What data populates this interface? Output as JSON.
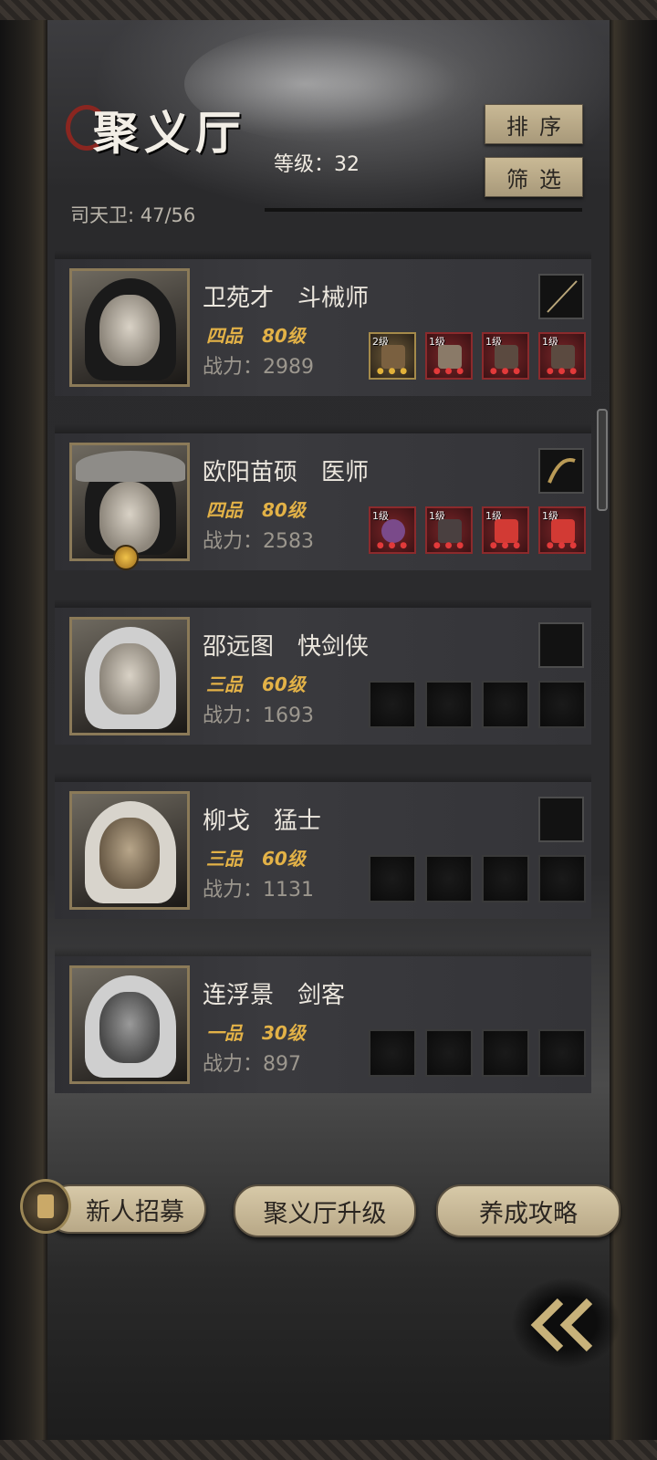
{
  "header": {
    "title": "聚义厅",
    "level": "等级：32",
    "guard_count": "司天卫: 47/56",
    "sort_label": "排序",
    "filter_label": "筛选"
  },
  "heroes": [
    {
      "name_line": "卫苑才　斗械师",
      "grade": "四品",
      "level": "80级",
      "power": "战力：2989",
      "equipment": [
        {
          "level": "2级",
          "icon": "crossbow-icon",
          "quality": "gold"
        },
        {
          "level": "1级",
          "icon": "armor-icon",
          "quality": "red"
        },
        {
          "level": "1级",
          "icon": "boots-icon",
          "quality": "red"
        },
        {
          "level": "1级",
          "icon": "boots-icon",
          "quality": "red"
        }
      ],
      "weapon_icon": "staff-icon"
    },
    {
      "name_line": "欧阳苗硕　医师",
      "grade": "四品",
      "level": "80级",
      "power": "战力：2583",
      "equipment": [
        {
          "level": "1级",
          "icon": "gourd-icon",
          "quality": "red"
        },
        {
          "level": "1级",
          "icon": "armor-icon",
          "quality": "red"
        },
        {
          "level": "1级",
          "icon": "fan-icon",
          "quality": "red"
        },
        {
          "level": "1级",
          "icon": "fan-icon",
          "quality": "red"
        }
      ],
      "weapon_icon": "whip-icon"
    },
    {
      "name_line": "邵远图　快剑侠",
      "grade": "三品",
      "level": "60级",
      "power": "战力：1693"
    },
    {
      "name_line": "柳戈　猛士",
      "grade": "三品",
      "level": "60级",
      "power": "战力：1131"
    },
    {
      "name_line": "连浮景　剑客",
      "grade": "一品",
      "level": "30级",
      "power": "战力：897"
    }
  ],
  "buttons": {
    "recruit": "新人招募",
    "upgrade": "聚义厅升级",
    "guide": "养成攻略"
  },
  "colors": {
    "accent_gold": "#e3b247",
    "button_bg": "#c9b995",
    "panel_bg": "#2f2f33"
  }
}
